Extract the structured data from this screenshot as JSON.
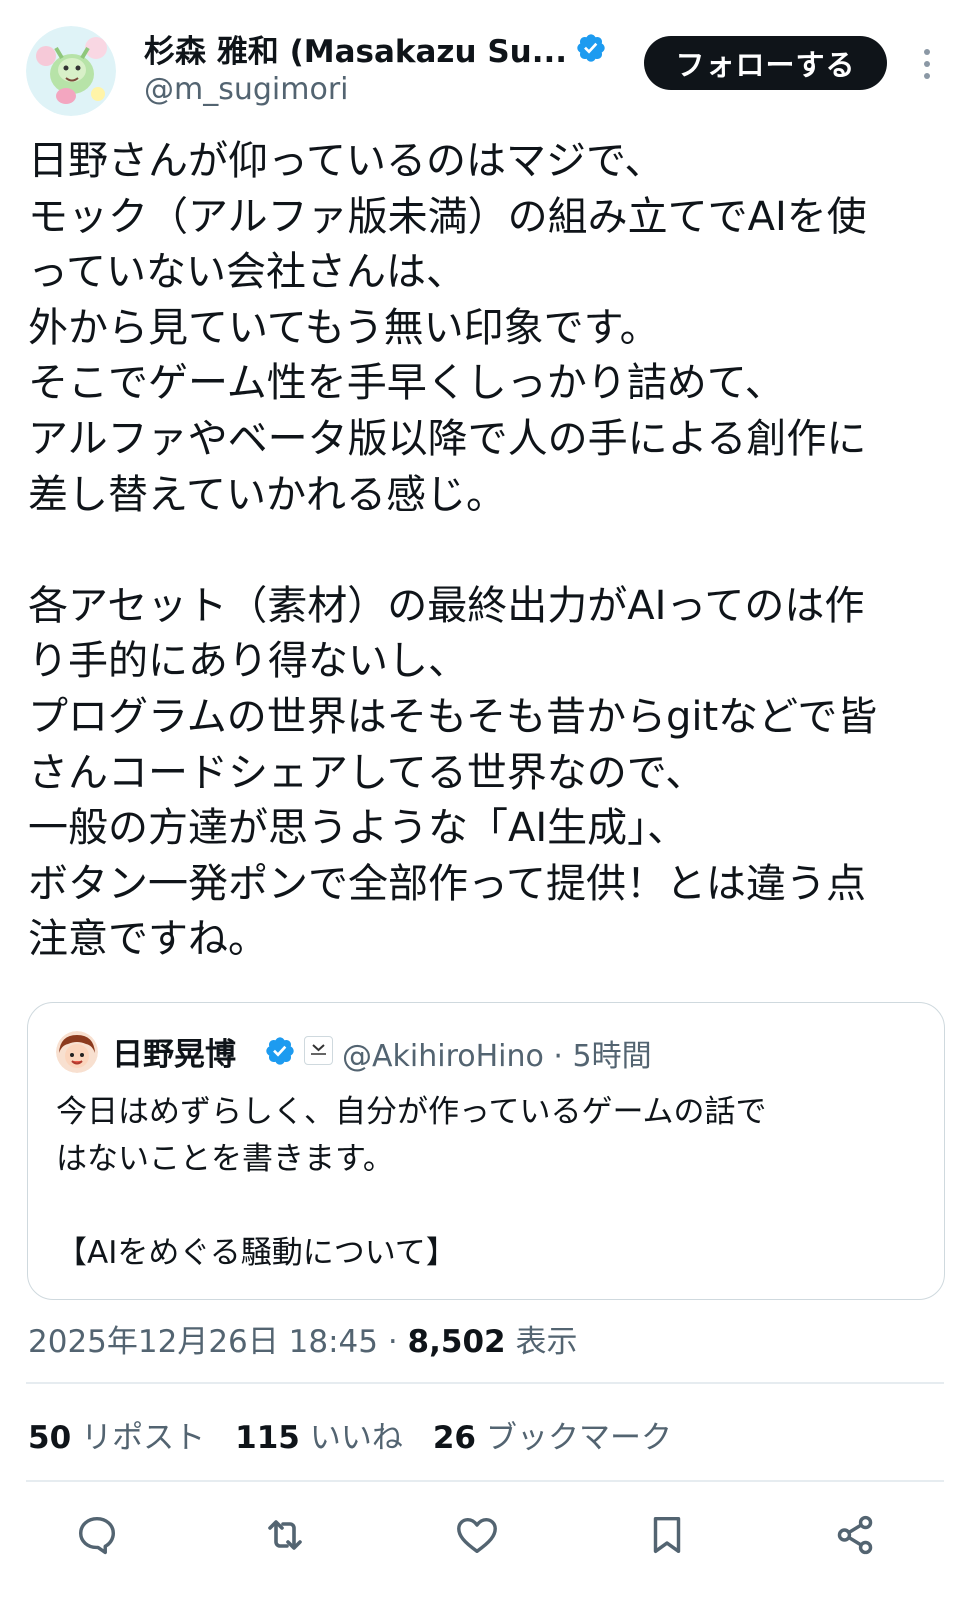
{
  "author": {
    "display_name": "杉森 雅和 (Masakazu Su...",
    "handle": "@m_sugimori",
    "verified": true
  },
  "follow_button_label": "フォローする",
  "tweet_text": "日野さんが仰っているのはマジで、\nモック（アルファ版未満）の組み立てでAIを使\nっていない会社さんは、\n外から見ていてもう無い印象です。\nそこでゲーム性を手早くしっかり詰めて、\nアルファやベータ版以降で人の手による創作に\n差し替えていかれる感じ。\n\n各アセット（素材）の最終出力がAIってのは作\nり手的にあり得ないし、\nプログラムの世界はそもそも昔からgitなどで皆\nさんコードシェアしてる世界なので、\n一般の方達が思うような「AI生成」、\nボタン一発ポンで全部作って提供！とは違う点\n注意ですね。",
  "quote": {
    "display_name": "日野晃博",
    "handle_time": "@AkihiroHino · 5時間",
    "text": "今日はめずらしく、自分が作っているゲームの話で\nはないことを書きます。\n\n【AIをめぐる騒動について】"
  },
  "meta": {
    "timestamp": "2025年12月26日 18:45 · ",
    "views_count": "8,502",
    "views_label": " 表示"
  },
  "stats": {
    "reposts_count": "50",
    "reposts_label": "リポスト",
    "likes_count": "115",
    "likes_label": "いいね",
    "bookmarks_count": "26",
    "bookmarks_label": "ブックマーク"
  },
  "colors": {
    "text": "#0f1419",
    "secondary": "#536471",
    "verified": "#1d9bf0",
    "border": "#cfd9de"
  },
  "icons": [
    "verified-badge-icon",
    "more-icon",
    "reply-icon",
    "repost-icon",
    "like-icon",
    "bookmark-icon",
    "share-icon"
  ]
}
